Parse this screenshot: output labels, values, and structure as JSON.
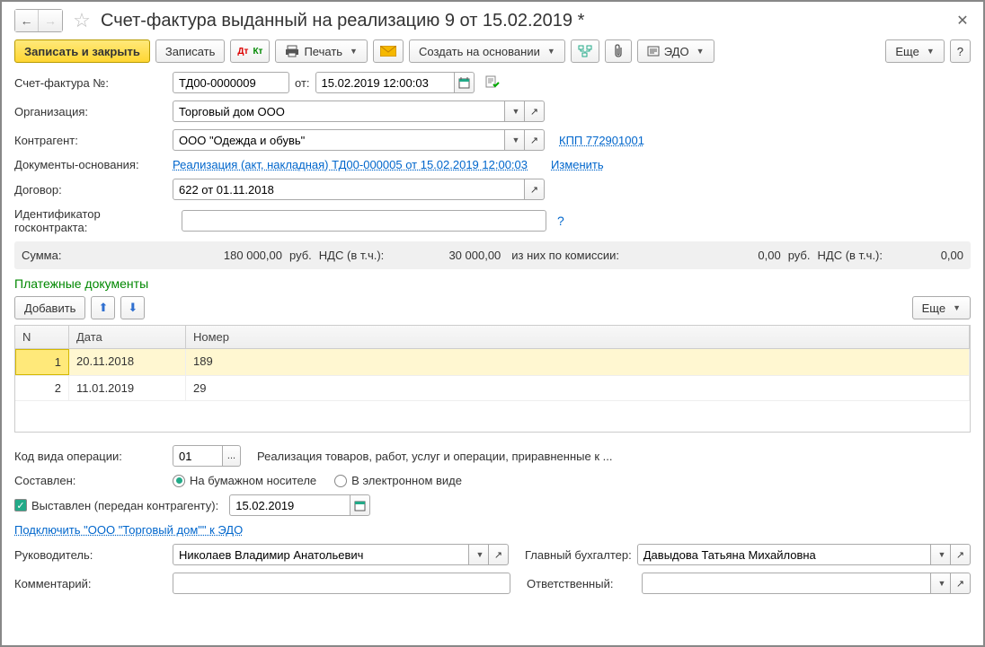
{
  "title": "Счет-фактура выданный на реализацию 9 от 15.02.2019 *",
  "toolbar": {
    "save_close": "Записать и закрыть",
    "save": "Записать",
    "print": "Печать",
    "create_base": "Создать на основании",
    "edo": "ЭДО",
    "more": "Еще"
  },
  "fields": {
    "invoice_no_label": "Счет-фактура №:",
    "invoice_no": "ТД00-0000009",
    "from_label": "от:",
    "date": "15.02.2019 12:00:03",
    "org_label": "Организация:",
    "org": "Торговый дом ООО",
    "counterparty_label": "Контрагент:",
    "counterparty": "ООО \"Одежда и обувь\"",
    "kpp_link": "КПП 772901001",
    "basis_label": "Документы-основания:",
    "basis_link": "Реализация (акт, накладная) ТД00-000005 от 15.02.2019 12:00:03",
    "change_link": "Изменить",
    "contract_label": "Договор:",
    "contract": "622 от 01.11.2018",
    "goscontract_label": "Идентификатор госконтракта:",
    "goscontract": ""
  },
  "sums": {
    "sum_label": "Сумма:",
    "sum_val": "180 000,00",
    "rub1": "руб.",
    "vat_label": "НДС (в т.ч.):",
    "vat_val": "30 000,00",
    "commission_label": "из них по комиссии:",
    "commission_val": "0,00",
    "rub2": "руб.",
    "vat2_label": "НДС (в т.ч.):",
    "vat2_val": "0,00"
  },
  "payments": {
    "title": "Платежные документы",
    "add": "Добавить",
    "more": "Еще",
    "col_n": "N",
    "col_date": "Дата",
    "col_num": "Номер",
    "rows": [
      {
        "n": "1",
        "date": "20.11.2018",
        "num": "189"
      },
      {
        "n": "2",
        "date": "11.01.2019",
        "num": "29"
      }
    ]
  },
  "bottom": {
    "op_code_label": "Код вида операции:",
    "op_code": "01",
    "op_desc": "Реализация товаров, работ, услуг и операции, приравненные к ...",
    "composed_label": "Составлен:",
    "paper": "На бумажном носителе",
    "electronic": "В электронном виде",
    "issued_label": "Выставлен (передан контрагенту):",
    "issued_date": "15.02.2019",
    "edo_connect_link": "Подключить \"ООО \"Торговый дом\"\" к ЭДО",
    "head_label": "Руководитель:",
    "head": "Николаев Владимир Анатольевич",
    "accountant_label": "Главный бухгалтер:",
    "accountant": "Давыдова Татьяна Михайловна",
    "comment_label": "Комментарий:",
    "comment": "",
    "responsible_label": "Ответственный:",
    "responsible": ""
  }
}
